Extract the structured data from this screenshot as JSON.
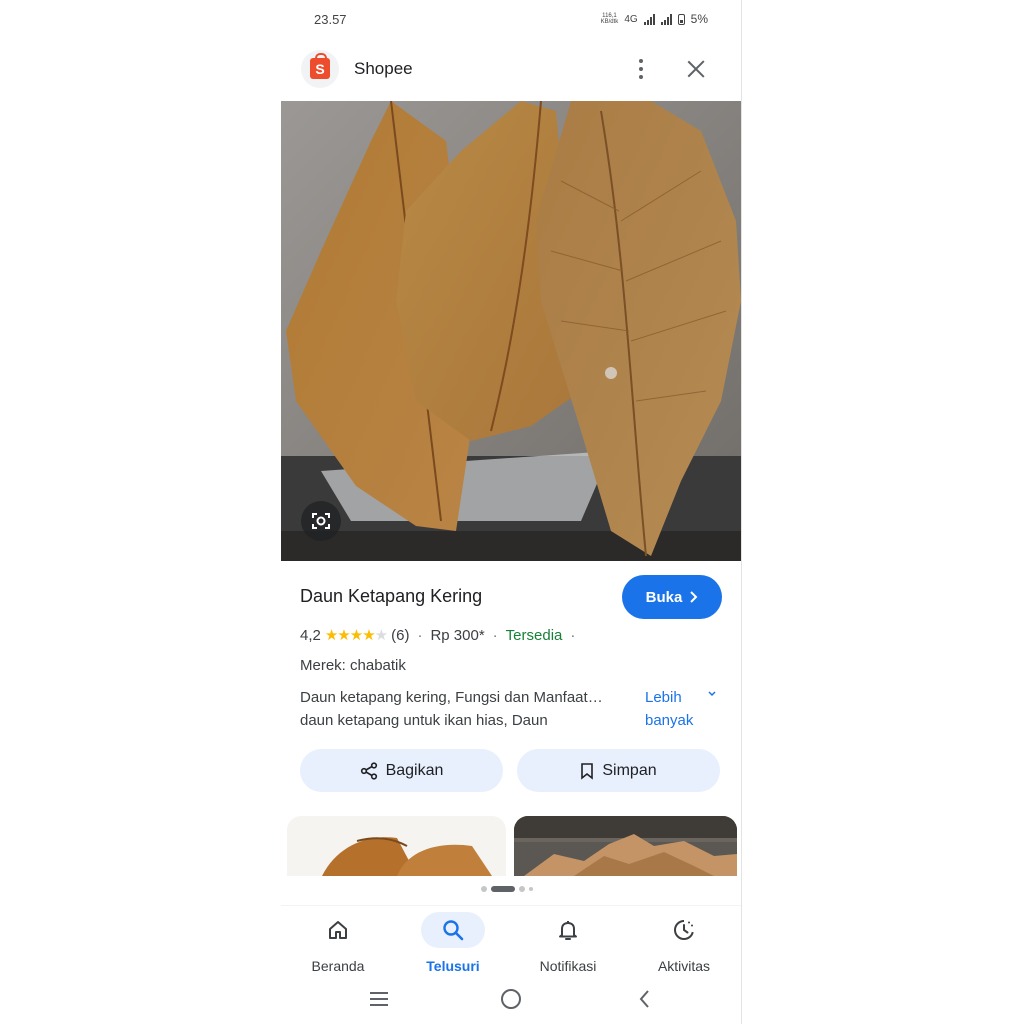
{
  "status_bar": {
    "time": "23.57",
    "net_speed_value": "116,1",
    "net_speed_unit": "KB/dtk",
    "network": "4G",
    "battery": "5%"
  },
  "header": {
    "site_name": "Shopee",
    "logo_letter": "S",
    "brand_color": "#ee4d2d"
  },
  "product": {
    "title": "Daun Ketapang Kering",
    "open_button": "Buka",
    "rating": "4,2",
    "rating_stars": 4.2,
    "reviews": "(6)",
    "price": "Rp 300*",
    "availability": "Tersedia",
    "brand": "Merek: chabatik",
    "description_line1": "Daun ketapang kering, Fungsi dan Manfaat…",
    "description_line2": "daun ketapang untuk ikan hias, Daun",
    "more_link_line1": "Lebih",
    "more_link_line2": "banyak"
  },
  "actions": {
    "share": "Bagikan",
    "save": "Simpan"
  },
  "bottom_nav": {
    "items": [
      {
        "label": "Beranda",
        "icon": "home-icon"
      },
      {
        "label": "Telusuri",
        "icon": "search-icon"
      },
      {
        "label": "Notifikasi",
        "icon": "bell-icon"
      },
      {
        "label": "Aktivitas",
        "icon": "history-icon"
      }
    ],
    "active_index": 1
  },
  "colors": {
    "accent": "#1a73e8",
    "available": "#188038",
    "star": "#fbbc04"
  }
}
